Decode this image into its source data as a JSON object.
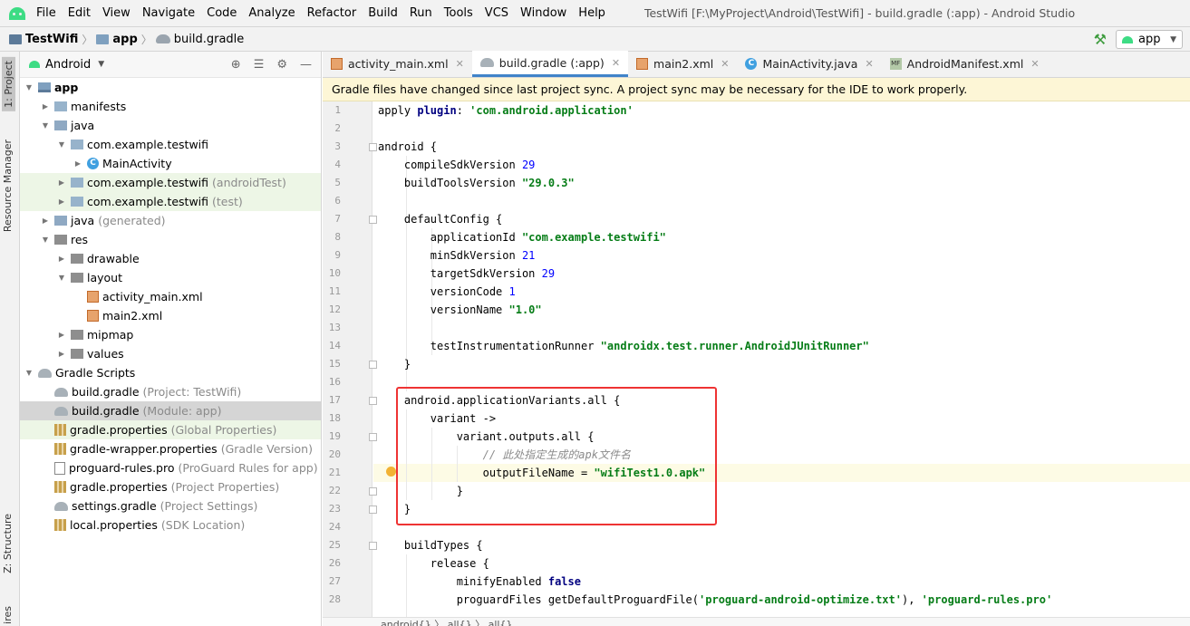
{
  "window_title": "TestWifi [F:\\MyProject\\Android\\TestWifi] - build.gradle (:app) - Android Studio",
  "menu": [
    "File",
    "Edit",
    "View",
    "Navigate",
    "Code",
    "Analyze",
    "Refactor",
    "Build",
    "Run",
    "Tools",
    "VCS",
    "Window",
    "Help"
  ],
  "nav": {
    "project": "TestWifi",
    "module": "app",
    "file": "build.gradle",
    "run_config": "app"
  },
  "toolwindows": {
    "project": "1: Project",
    "resource_manager": "Resource Manager",
    "structure": "Z: Structure",
    "bottom": "ires"
  },
  "project_panel": {
    "view_mode": "Android",
    "tree": [
      {
        "label": "app",
        "hint": ""
      },
      {
        "label": "manifests",
        "hint": ""
      },
      {
        "label": "java",
        "hint": ""
      },
      {
        "label": "com.example.testwifi",
        "hint": ""
      },
      {
        "label": "MainActivity",
        "hint": ""
      },
      {
        "label": "com.example.testwifi",
        "hint": "(androidTest)"
      },
      {
        "label": "com.example.testwifi",
        "hint": "(test)"
      },
      {
        "label": "java",
        "hint": "(generated)"
      },
      {
        "label": "res",
        "hint": ""
      },
      {
        "label": "drawable",
        "hint": ""
      },
      {
        "label": "layout",
        "hint": ""
      },
      {
        "label": "activity_main.xml",
        "hint": ""
      },
      {
        "label": "main2.xml",
        "hint": ""
      },
      {
        "label": "mipmap",
        "hint": ""
      },
      {
        "label": "values",
        "hint": ""
      },
      {
        "label": "Gradle Scripts",
        "hint": ""
      },
      {
        "label": "build.gradle",
        "hint": "(Project: TestWifi)"
      },
      {
        "label": "build.gradle",
        "hint": "(Module: app)"
      },
      {
        "label": "gradle.properties",
        "hint": "(Global Properties)"
      },
      {
        "label": "gradle-wrapper.properties",
        "hint": "(Gradle Version)"
      },
      {
        "label": "proguard-rules.pro",
        "hint": "(ProGuard Rules for app)"
      },
      {
        "label": "gradle.properties",
        "hint": "(Project Properties)"
      },
      {
        "label": "settings.gradle",
        "hint": "(Project Settings)"
      },
      {
        "label": "local.properties",
        "hint": "(SDK Location)"
      }
    ]
  },
  "tabs": [
    "activity_main.xml",
    "build.gradle (:app)",
    "main2.xml",
    "MainActivity.java",
    "AndroidManifest.xml"
  ],
  "mf_badge": "MF",
  "banner": "Gradle files have changed since last project sync. A project sync may be necessary for the IDE to work properly.",
  "line_numbers": [
    "1",
    "2",
    "3",
    "4",
    "5",
    "6",
    "7",
    "8",
    "9",
    "10",
    "11",
    "12",
    "13",
    "14",
    "15",
    "16",
    "17",
    "18",
    "19",
    "20",
    "21",
    "22",
    "23",
    "24",
    "25",
    "26",
    "27",
    "28"
  ],
  "code": {
    "l1a": "apply ",
    "l1b": "plugin",
    "l1c": ": ",
    "l1d": "'com.android.application'",
    "l3": "android {",
    "l4a": "    compileSdkVersion ",
    "l4b": "29",
    "l5a": "    buildToolsVersion ",
    "l5b": "\"29.0.3\"",
    "l7": "    defaultConfig {",
    "l8a": "        applicationId ",
    "l8b": "\"com.example.testwifi\"",
    "l9a": "        minSdkVersion ",
    "l9b": "21",
    "l10a": "        targetSdkVersion ",
    "l10b": "29",
    "l11a": "        versionCode ",
    "l11b": "1",
    "l12a": "        versionName ",
    "l12b": "\"1.0\"",
    "l14a": "        testInstrumentationRunner ",
    "l14b": "\"androidx.test.runner.AndroidJUnitRunner\"",
    "l15": "    }",
    "l17": "    android.applicationVariants.all {",
    "l18": "        variant ->",
    "l19": "            variant.outputs.all {",
    "l20": "                // 此处指定生成的apk文件名",
    "l21a": "                outputFileName = ",
    "l21b": "\"wifiTest1.0.apk\"",
    "l22": "            }",
    "l23": "    }",
    "l25": "    buildTypes {",
    "l26": "        release {",
    "l27a": "            minifyEnabled ",
    "l27b": "false",
    "l28a": "            proguardFiles getDefaultProguardFile(",
    "l28b": "'proguard-android-optimize.txt'",
    "l28c": "), ",
    "l28d": "'proguard-rules.pro'"
  },
  "breadcrumb_bottom": "android{}  〉 all{}  〉 all{}"
}
